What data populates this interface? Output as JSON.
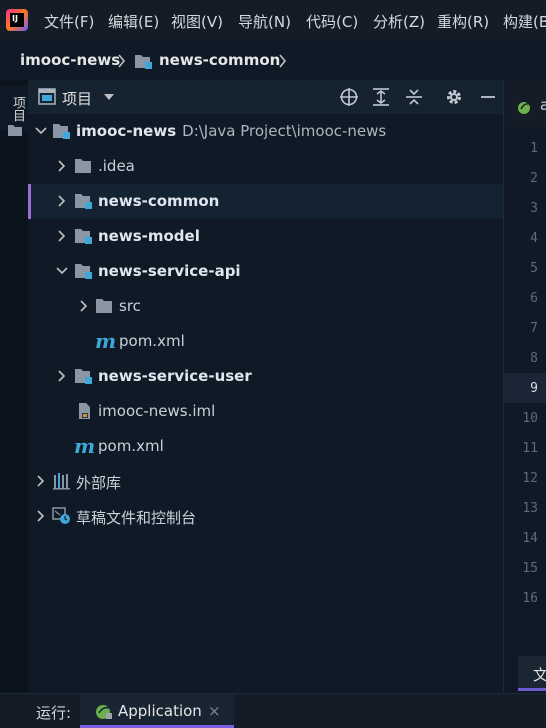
{
  "menubar": {
    "items": [
      "文件(F)",
      "编辑(E)",
      "视图(V)",
      "导航(N)",
      "代码(C)",
      "分析(Z)",
      "重构(R)",
      "构建(B)"
    ]
  },
  "breadcrumb": {
    "items": [
      "imooc-news",
      "news-common"
    ]
  },
  "left_stripe": {
    "tab_label": "项目"
  },
  "project_panel": {
    "title": "项目"
  },
  "tree": {
    "root": {
      "name": "imooc-news",
      "path": "D:\\Java Project\\imooc-news"
    },
    "idea": ".idea",
    "news_common": "news-common",
    "news_model": "news-model",
    "news_service_api": "news-service-api",
    "src": "src",
    "pom_api": "pom.xml",
    "news_service_user": "news-service-user",
    "iml": "imooc-news.iml",
    "pom_root": "pom.xml",
    "external_libs": "外部库",
    "scratches": "草稿文件和控制台"
  },
  "editor": {
    "line_numbers": [
      "1",
      "2",
      "3",
      "4",
      "5",
      "6",
      "7",
      "8",
      "9",
      "10",
      "11",
      "12",
      "13",
      "14",
      "15",
      "16"
    ],
    "current_line": "9",
    "tab_partial": "a",
    "bottom_tab_partial": "文"
  },
  "runbar": {
    "label": "运行:",
    "tab": "Application",
    "close": "×"
  },
  "colors": {
    "accent": "#9b6bd6",
    "module_badge": "#3fa8d8",
    "background": "#0f1a26"
  }
}
